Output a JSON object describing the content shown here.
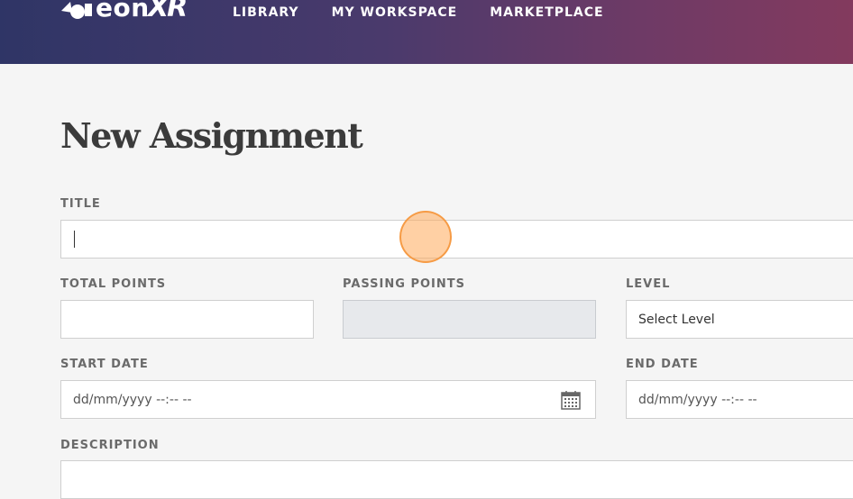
{
  "app": {
    "logo_text": "eon",
    "logo_xr": "XR"
  },
  "nav": {
    "items": [
      {
        "label": "LIBRARY"
      },
      {
        "label": "MY WORKSPACE"
      },
      {
        "label": "MARKETPLACE"
      }
    ]
  },
  "page": {
    "title": "New Assignment"
  },
  "form": {
    "title_label": "TITLE",
    "title_value": "",
    "total_points_label": "TOTAL POINTS",
    "total_points_value": "",
    "passing_points_label": "PASSING POINTS",
    "passing_points_value": "",
    "level_label": "LEVEL",
    "level_value": "Select Level",
    "start_date_label": "START DATE",
    "start_date_placeholder": "dd/mm/yyyy --:-- --",
    "end_date_label": "END DATE",
    "end_date_placeholder": "dd/mm/yyyy --:-- --",
    "description_label": "DESCRIPTION"
  },
  "colors": {
    "header_gradient_start": "#2f3566",
    "header_gradient_end": "#833a5e",
    "background": "#f5f5f5",
    "click_marker": "#f5a25a"
  },
  "icons": {
    "date_picker": "calendar-icon",
    "logo": "eon-logo-icon"
  }
}
